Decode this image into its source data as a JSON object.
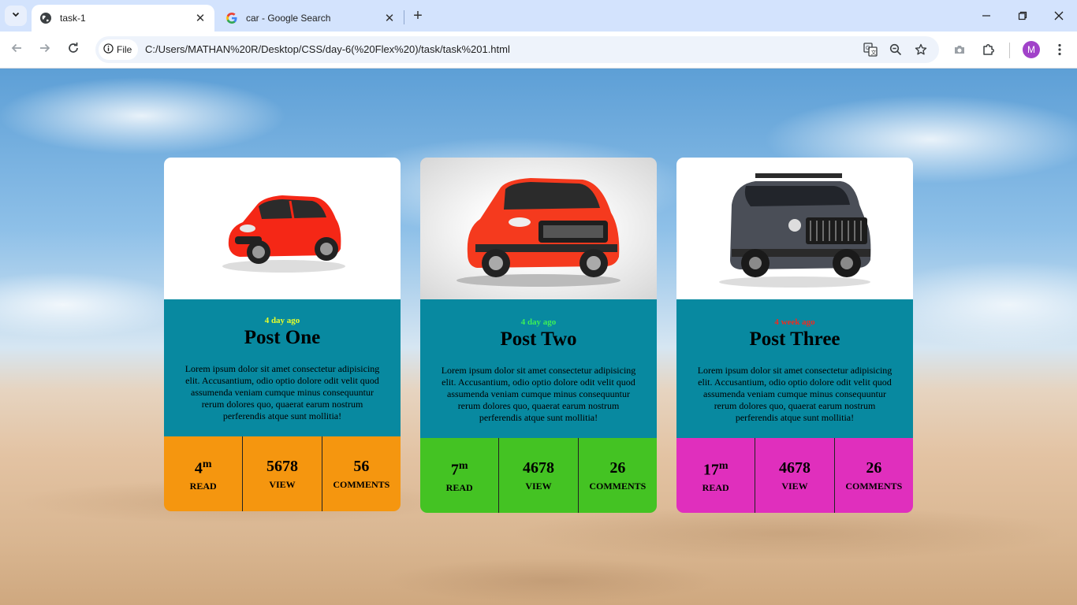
{
  "browser": {
    "tabs": [
      {
        "title": "task-1",
        "active": true,
        "favicon": "globe-icon"
      },
      {
        "title": "car - Google Search",
        "active": false,
        "favicon": "google-icon"
      }
    ],
    "file_chip": "File",
    "url": "C:/Users/MATHAN%20R/Desktop/CSS/day-6(%20Flex%20)/task/task%201.html",
    "avatar_letter": "M"
  },
  "cards": [
    {
      "ago": "4 day ago",
      "ago_color": "#e8ff2a",
      "title": "Post One",
      "text": "Lorem ipsum dolor sit amet consectetur adipisicing elit. Accusantium, odio optio dolore odit velit quod assumenda veniam cumque minus consequuntur rerum dolores quo, quaerat earum nostrum perferendis atque sunt mollitia!",
      "stats_color": "#f5960f",
      "read_num": "4",
      "read_sup": "m",
      "read_label": "READ",
      "view_num": "5678",
      "view_label": "VIEW",
      "comments_num": "56",
      "comments_label": "COMMENTS",
      "car_color": "#f52716",
      "car": "hatchback"
    },
    {
      "ago": "4 day ago",
      "ago_color": "#3cf058",
      "title": "Post Two",
      "text": "Lorem ipsum dolor sit amet consectetur adipisicing elit. Accusantium, odio optio dolore odit velit quod assumenda veniam cumque minus consequuntur rerum dolores quo, quaerat earum nostrum perferendis atque sunt mollitia!",
      "stats_color": "#44c323",
      "read_num": "7",
      "read_sup": "m",
      "read_label": "READ",
      "view_num": "4678",
      "view_label": "VIEW",
      "comments_num": "26",
      "comments_label": "COMMENTS",
      "car_color": "#f53a1e",
      "car": "suv"
    },
    {
      "ago": "4 week ago",
      "ago_color": "#f02a20",
      "title": "Post Three",
      "text": "Lorem ipsum dolor sit amet consectetur adipisicing elit. Accusantium, odio optio dolore odit velit quod assumenda veniam cumque minus consequuntur rerum dolores quo, quaerat earum nostrum perferendis atque sunt mollitia!",
      "stats_color": "#e02fbd",
      "read_num": "17",
      "read_sup": "m",
      "read_label": "READ",
      "view_num": "4678",
      "view_label": "VIEW",
      "comments_num": "26",
      "comments_label": "COMMENTS",
      "car_color": "#4a4e57",
      "car": "offroader"
    }
  ]
}
